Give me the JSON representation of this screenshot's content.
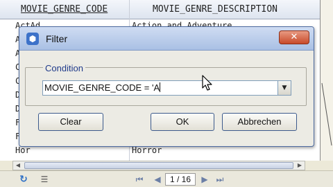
{
  "grid": {
    "columns": [
      "MOVIE_GENRE_CODE",
      "MOVIE_GENRE_DESCRIPTION"
    ],
    "rows": [
      {
        "code": "ActAd",
        "desc": "Action and Adventure"
      },
      {
        "code": "A",
        "desc": ""
      },
      {
        "code": "A",
        "desc": ""
      },
      {
        "code": "C",
        "desc": ""
      },
      {
        "code": "C",
        "desc": ""
      },
      {
        "code": "D",
        "desc": ""
      },
      {
        "code": "D",
        "desc": ""
      },
      {
        "code": "F",
        "desc": ""
      },
      {
        "code": "F",
        "desc": ""
      },
      {
        "code": "Hor",
        "desc": "Horror"
      }
    ]
  },
  "dialog": {
    "title": "Filter",
    "close_label": "✕",
    "group_label": "Condition",
    "condition_value": "MOVIE_GENRE_CODE = 'A",
    "clear_label": "Clear",
    "ok_label": "OK",
    "cancel_label": "Abbrechen"
  },
  "navigator": {
    "page_label": "1 / 16"
  },
  "icons": {
    "filter": "filter-icon",
    "close": "close-icon",
    "dropdown": "chevron-down-icon",
    "refresh": "refresh-icon",
    "list": "list-icon",
    "first": "first-page-icon",
    "prev": "prev-page-icon",
    "next": "next-page-icon",
    "last": "last-page-icon"
  },
  "colors": {
    "title_gradient_top": "#cfdcf2",
    "title_gradient_bottom": "#a9c0e4",
    "close_button": "#c84a2a",
    "group_label": "#1f3a8a"
  }
}
